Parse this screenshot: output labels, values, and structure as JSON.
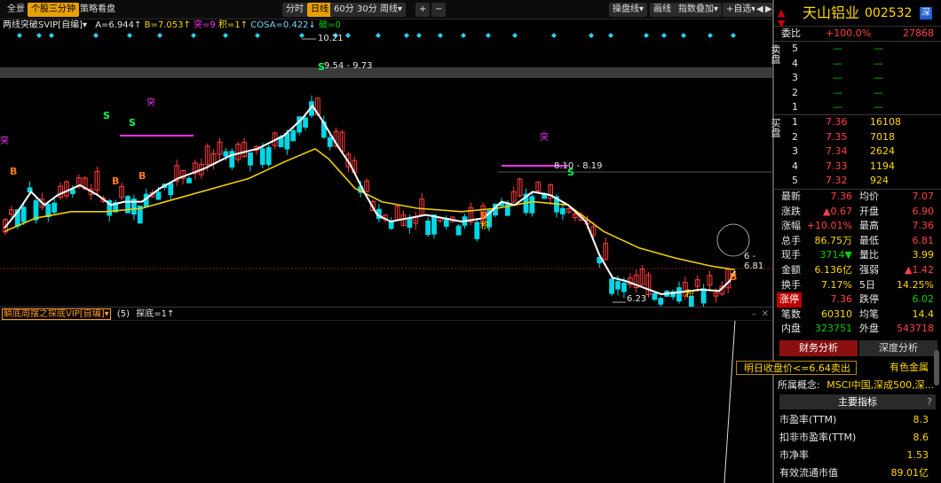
{
  "toolbar": {
    "left_tabs": [
      "全景",
      "个股三分钟",
      "策略看盘"
    ],
    "periods": [
      "分时",
      "日线",
      "60分",
      "30分",
      "周线▾"
    ],
    "zoom": [
      "+",
      "−"
    ],
    "right_buttons": [
      "操盘线▾",
      "画线",
      "指数叠加▾",
      "+自选▾"
    ],
    "nav": [
      "◀",
      "▶"
    ]
  },
  "indicator": {
    "name": "两线突破SVIP[自编]▾",
    "a": "A=6.944↑",
    "b": "B=7.053↑",
    "tu": "突=9",
    "ji": "积=1↑",
    "cosa": "COSA=0.422↓",
    "po": "破=0"
  },
  "chart_labels": {
    "high": "10.21",
    "range1": "9.54 - 9.73",
    "range2": "8.10 - 8.19",
    "low": "6.23",
    "right": "6 - 6.81",
    "tu1": "突",
    "tu2": "突",
    "tu3": "突",
    "s1": "S",
    "s2": "S",
    "s3": "S",
    "s4": "S",
    "b1": "B",
    "b2": "B",
    "b3": "B",
    "b4": "B",
    "b5": "B",
    "ji1": "积",
    "ji2": "积"
  },
  "subchart": {
    "name": "躺底周摆之探底VIP[自编]▾",
    "num": "(5)",
    "value": "探底=1↑"
  },
  "stock": {
    "name": "天山铝业",
    "code": "002532",
    "badge": "深"
  },
  "order": {
    "wei_bi_label": "委比",
    "wei_bi": "+100.0%",
    "wei_cha": "27868",
    "sell_side": "卖盘",
    "buy_side": "买盘",
    "sell": [
      {
        "lvl": "5",
        "price": "—",
        "vol": "—"
      },
      {
        "lvl": "4",
        "price": "—",
        "vol": "—"
      },
      {
        "lvl": "3",
        "price": "—",
        "vol": "—"
      },
      {
        "lvl": "2",
        "price": "—",
        "vol": "—"
      },
      {
        "lvl": "1",
        "price": "—",
        "vol": "—"
      }
    ],
    "buy": [
      {
        "lvl": "1",
        "price": "7.36",
        "vol": "16108"
      },
      {
        "lvl": "2",
        "price": "7.35",
        "vol": "7018"
      },
      {
        "lvl": "3",
        "price": "7.34",
        "vol": "2624"
      },
      {
        "lvl": "4",
        "price": "7.33",
        "vol": "1194"
      },
      {
        "lvl": "5",
        "price": "7.32",
        "vol": "924"
      }
    ]
  },
  "quote": [
    {
      "k1": "最新",
      "v1": "7.36",
      "c1": "red",
      "k2": "均价",
      "v2": "7.07",
      "c2": "red"
    },
    {
      "k1": "涨跌",
      "v1": "▲0.67",
      "c1": "red",
      "k2": "开盘",
      "v2": "6.90",
      "c2": "red"
    },
    {
      "k1": "涨幅",
      "v1": "+10.01%",
      "c1": "red",
      "k2": "最高",
      "v2": "7.36",
      "c2": "red"
    },
    {
      "k1": "总手",
      "v1": "86.75万",
      "c1": "yellow",
      "k2": "最低",
      "v2": "6.81",
      "c2": "red"
    },
    {
      "k1": "现手",
      "v1": "3714▼",
      "c1": "green",
      "k2": "量比",
      "v2": "3.99",
      "c2": "yellow"
    },
    {
      "k1": "金额",
      "v1": "6.136亿",
      "c1": "yellow",
      "k2": "强弱",
      "v2": "▲1.42",
      "c2": "red"
    },
    {
      "k1": "换手",
      "v1": "7.17%",
      "c1": "yellow",
      "k2": "5日",
      "v2": "14.25%",
      "c2": "yellow"
    },
    {
      "k1": "涨停",
      "v1": "7.36",
      "c1": "red",
      "k2": "跌停",
      "v2": "6.02",
      "c2": "green"
    },
    {
      "k1": "笔数",
      "v1": "60310",
      "c1": "yellow",
      "k2": "均笔",
      "v2": "14.4",
      "c2": "yellow"
    },
    {
      "k1": "内盘",
      "v1": "323751",
      "c1": "green",
      "k2": "外盘",
      "v2": "543718",
      "c2": "red"
    }
  ],
  "tabs": {
    "t1": "财务分析",
    "t2": "深度分析"
  },
  "tooltip": "明日收盘价<=6.64卖出",
  "industry": "有色金属",
  "concept_label": "所属概念:",
  "concept_value": "MSCI中国,深成500,深...",
  "main_index": "主要指标",
  "help": "?",
  "metrics": [
    {
      "k": "市盈率(TTM)",
      "v": "8.3"
    },
    {
      "k": "扣非市盈率(TTM)",
      "v": "8.6"
    },
    {
      "k": "市净率",
      "v": "1.53"
    },
    {
      "k": "有效流通市值",
      "v": "89.01亿"
    }
  ],
  "colors": {
    "up": "#ff3b3b",
    "down": "#00d7e6",
    "ma_white": "#ffffff",
    "ma_yellow": "#f0d000",
    "accent": "#e8a000",
    "magenta": "#ff33ff"
  }
}
